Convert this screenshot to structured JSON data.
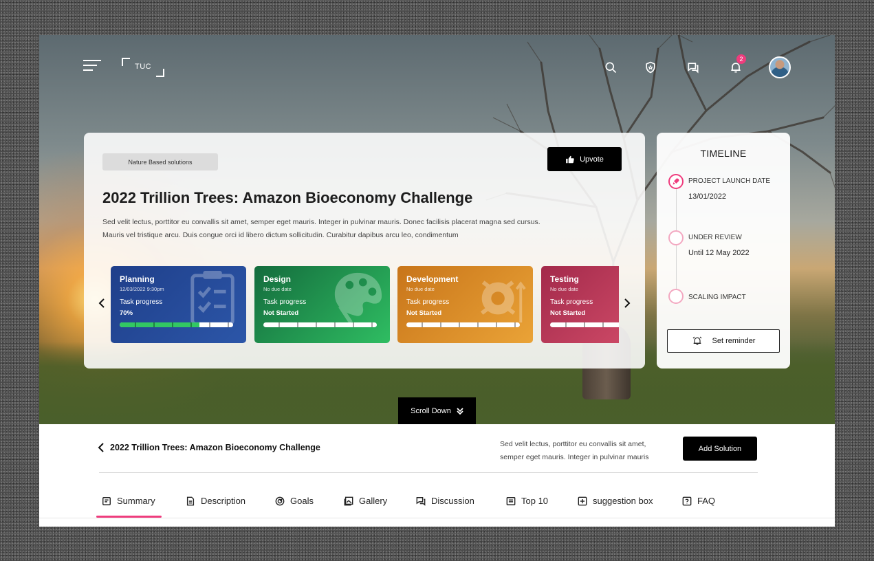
{
  "header": {
    "logo_text": "TUC",
    "notification_count": "2",
    "icons": [
      "menu-icon",
      "search-icon",
      "shield-icon",
      "chat-icon",
      "bell-icon",
      "avatar"
    ]
  },
  "hero": {
    "tag": "Nature Based solutions",
    "upvote_label": "Upvote",
    "title": "2022 Trillion Trees: Amazon Bioeconomy Challenge",
    "description": "Sed velit lectus, porttitor eu convallis sit amet, semper eget mauris. Integer in pulvinar mauris. Donec facilisis placerat magna sed cursus. Mauris vel tristique arcu. Duis congue orci id libero dictum sollicitudin. Curabitur dapibus arcu leo, condimentum",
    "stages": [
      {
        "title": "Planning",
        "date": "12/03/2022  9:30pm",
        "progress_label": "Task progress",
        "progress_value": "70%",
        "progress": 0.7,
        "color": "#1f3f8a"
      },
      {
        "title": "Design",
        "date": "No due date",
        "progress_label": "Task progress",
        "progress_value": "Not Started",
        "progress": 0,
        "color": "#146c3d"
      },
      {
        "title": "Development",
        "date": "No due date",
        "progress_label": "Task progress",
        "progress_value": "Not Started",
        "progress": 0,
        "color": "#c8751a"
      },
      {
        "title": "Testing",
        "date": "No due date",
        "progress_label": "Task progress",
        "progress_value": "Not Started",
        "progress": 0,
        "color": "#a32a4b"
      }
    ],
    "scroll_label": "Scroll Down"
  },
  "timeline": {
    "title": "TIMELINE",
    "items": [
      {
        "label": "PROJECT LAUNCH DATE",
        "value": "13/01/2022"
      },
      {
        "label": "UNDER REVIEW",
        "value": "Until 12 May 2022"
      },
      {
        "label": "SCALING IMPACT",
        "value": ""
      }
    ],
    "reminder_label": "Set reminder"
  },
  "subbar": {
    "back_title": "2022 Trillion Trees: Amazon Bioeconomy Challenge",
    "description": "Sed velit lectus, porttitor eu convallis sit amet, semper eget mauris. Integer in pulvinar mauris",
    "add_solution_label": "Add Solution"
  },
  "tabs": [
    {
      "label": "Summary",
      "icon": "summary-icon",
      "active": true
    },
    {
      "label": "Description",
      "icon": "document-icon"
    },
    {
      "label": "Goals",
      "icon": "target-icon"
    },
    {
      "label": "Gallery",
      "icon": "gallery-icon"
    },
    {
      "label": "Discussion",
      "icon": "chat-icon"
    },
    {
      "label": "Top 10",
      "icon": "list-icon"
    },
    {
      "label": "suggestion box",
      "icon": "suggestion-icon"
    },
    {
      "label": "FAQ",
      "icon": "faq-icon"
    }
  ],
  "colors": {
    "accent": "#ef3c7d",
    "button": "#000000"
  }
}
